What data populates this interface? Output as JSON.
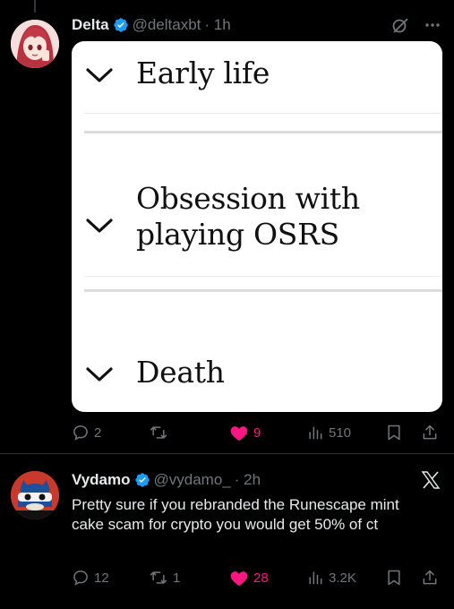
{
  "tweets": [
    {
      "author": {
        "name": "Delta",
        "handle": "@deltaxbt",
        "time": "· 1h",
        "verified": true
      },
      "media_card": {
        "sections": [
          {
            "title": "Early life"
          },
          {
            "title": "Obsession with playing OSRS"
          },
          {
            "title": "Death"
          }
        ]
      },
      "actions": {
        "replies": "2",
        "reposts": "",
        "likes": "9",
        "views": "510"
      }
    },
    {
      "author": {
        "name": "Vydamo",
        "handle": "@vydamo_",
        "time": "· 2h",
        "verified": true
      },
      "text": "Pretty sure if you rebranded the Runescape mint cake scam for crypto you would get 50% of ct",
      "actions": {
        "replies": "12",
        "reposts": "1",
        "likes": "28",
        "views": "3.2K"
      }
    }
  ],
  "colors": {
    "background": "#000000",
    "text": "#e7e9ea",
    "muted": "#71767b",
    "verified": "#1d9bf0",
    "like": "#f91880"
  },
  "icons": [
    "reply-icon",
    "repost-icon",
    "heart-icon",
    "views-icon",
    "bookmark-icon",
    "share-icon",
    "grok-icon",
    "more-icon",
    "x-logo-icon",
    "verified-badge-icon"
  ]
}
